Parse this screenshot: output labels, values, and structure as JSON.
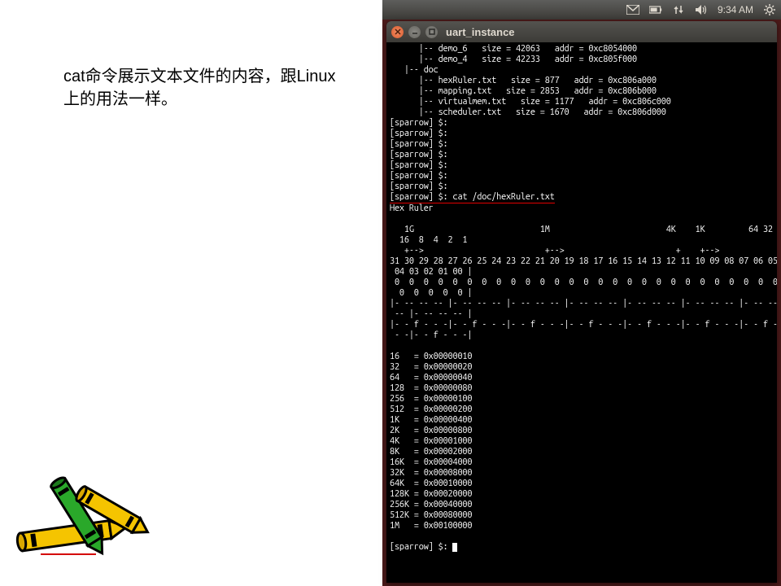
{
  "left_text_line1": "cat命令展示文本文件的内容，跟Linux",
  "left_text_line2": "上的用法一样。",
  "topbar": {
    "time": "9:34 AM"
  },
  "terminal": {
    "title": "uart_instance",
    "tree_lines": [
      "      |-- demo_6   size = 42063   addr = 0xc8054000",
      "      |-- demo_4   size = 42233   addr = 0xc805f000",
      "   |-- doc",
      "      |-- hexRuler.txt   size = 877   addr = 0xc806a000",
      "      |-- mapping.txt   size = 2853   addr = 0xc806b000",
      "      |-- virtualmem.txt   size = 1177   addr = 0xc806c000",
      "      |-- scheduler.txt   size = 1670   addr = 0xc806d000"
    ],
    "prompts_empty_count": 7,
    "prompt": "[sparrow] $:",
    "command": " cat /doc/hexRuler.txt",
    "output_header": "Hex Ruler",
    "ruler_lines": [
      "",
      "   1G                          1M                        4K    1K         64 32",
      "  16  8  4  2  1",
      "   +-->                         +-->                       +    +-->",
      "31 30 29 28 27 26 25 24 23 22 21 20 19 18 17 16 15 14 13 12 11 10 09 08 07 06 05",
      " 04 03 02 01 00 |",
      " 0  0  0  0  0  0  0  0  0  0  0  0  0  0  0  0  0  0  0  0  0  0  0  0  0  0  0",
      "  0  0  0  0  0 |",
      "|- -- -- -- |- -- -- -- |- -- -- -- |- -- -- -- |- -- -- -- |- -- -- -- |- -- --",
      " -- |- -- -- -- |",
      "|- - f - - -|- - f - - -|- - f - - -|- - f - - -|- - f - - -|- - f - - -|- - f -",
      " - -|- - f - - -|"
    ],
    "hex_table": [
      "16   = 0x00000010",
      "32   = 0x00000020",
      "64   = 0x00000040",
      "128  = 0x00000080",
      "256  = 0x00000100",
      "512  = 0x00000200",
      "1K   = 0x00000400",
      "2K   = 0x00000800",
      "4K   = 0x00001000",
      "8K   = 0x00002000",
      "16K  = 0x00004000",
      "32K  = 0x00008000",
      "64K  = 0x00010000",
      "128K = 0x00020000",
      "256K = 0x00040000",
      "512K = 0x00080000",
      "1M   = 0x00100000"
    ],
    "final_prompt": "[sparrow] $: "
  }
}
